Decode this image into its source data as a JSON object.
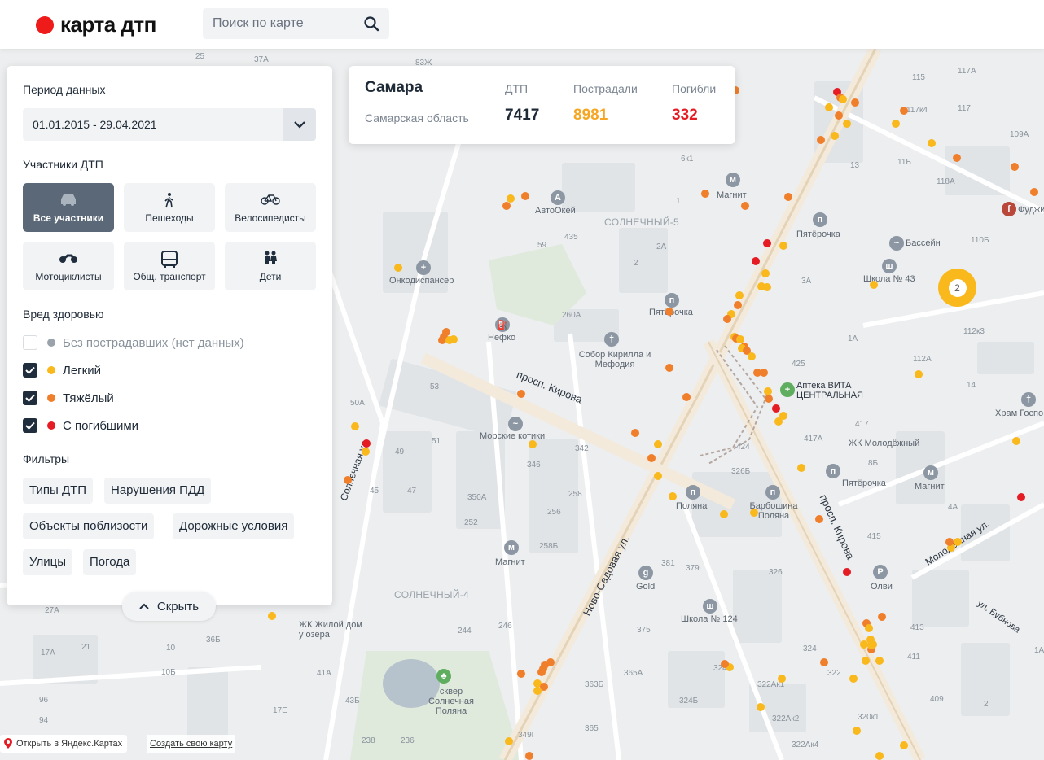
{
  "header": {
    "logo_text": "карта дтп",
    "search_placeholder": "Поиск по карте"
  },
  "stats": {
    "city": "Самара",
    "region": "Самарская область",
    "columns": [
      {
        "label": "ДТП",
        "value": "7417",
        "color": "#1f2a37"
      },
      {
        "label": "Пострадали",
        "value": "8981",
        "color": "#f5a623"
      },
      {
        "label": "Погибли",
        "value": "332",
        "color": "#e51c23"
      }
    ]
  },
  "panel": {
    "period_title": "Период данных",
    "period_value": "01.01.2015 - 29.04.2021",
    "participants_title": "Участники ДТП",
    "participants": [
      {
        "label": "Все участники",
        "icon": "car-icon",
        "active": true
      },
      {
        "label": "Пешеходы",
        "icon": "pedestrian-icon",
        "active": false
      },
      {
        "label": "Велосипедисты",
        "icon": "bicycle-icon",
        "active": false
      },
      {
        "label": "Мотоциклисты",
        "icon": "motorcycle-icon",
        "active": false
      },
      {
        "label": "Общ. транспорт",
        "icon": "bus-icon",
        "active": false
      },
      {
        "label": "Дети",
        "icon": "children-icon",
        "active": false
      }
    ],
    "harm_title": "Вред здоровью",
    "harm": [
      {
        "label": "Без пострадавших (нет данных)",
        "checked": false,
        "color": "#9aa2ab"
      },
      {
        "label": "Легкий",
        "checked": true,
        "color": "#f9b81b"
      },
      {
        "label": "Тяжёлый",
        "checked": true,
        "color": "#f07f2c"
      },
      {
        "label": "С погибшими",
        "checked": true,
        "color": "#e51c23"
      }
    ],
    "filters_title": "Фильтры",
    "filters": [
      "Типы ДТП",
      "Нарушения ПДД",
      "Объекты поблизости",
      "Дорожные условия",
      "Улицы",
      "Погода"
    ],
    "hide_label": "Скрыть"
  },
  "map": {
    "district_labels": [
      "СОЛНЕЧНЫЙ-5",
      "СОЛНЕЧНЫЙ-4"
    ],
    "street_labels": [
      "просп. Кирова",
      "Ново-Садовая ул.",
      "просп. Кирова",
      "Молодёжная ул.",
      "Солнечная ул.",
      "ул. Бубнова"
    ],
    "poi_labels": [
      "АвтоОкей",
      "Магнит",
      "Пятёрочка",
      "Бассейн",
      "Школа № 43",
      "Онкодиспансер",
      "Пятёрочка",
      "Нефко",
      "Собор Кирилла и Мефодия",
      "Аптека ВИТА ЦЕНТРАЛЬНАЯ",
      "Храм Госпо",
      "Морские котики",
      "ЖК Молодёжный",
      "Пятёрочка",
      "Магнит",
      "Поляна",
      "Барбошина Поляна",
      "Магнит",
      "Gold",
      "Олви",
      "Школа № 124",
      "ЖК Жилой дом у озера",
      "сквер Солнечная Поляна",
      "Фуджи"
    ],
    "house_numbers": [
      "25",
      "37А",
      "83Ж",
      "117А",
      "115",
      "117",
      "117к4",
      "109А",
      "11Б",
      "118А",
      "110Б",
      "13",
      "6к1",
      "1",
      "435",
      "59",
      "2А",
      "2",
      "3А",
      "1А",
      "425",
      "112А",
      "112к3",
      "14",
      "417",
      "417А",
      "8Б",
      "4А",
      "415",
      "260А",
      "53",
      "50А",
      "49",
      "51",
      "47",
      "45",
      "346",
      "342",
      "258",
      "256",
      "350А",
      "252",
      "258Б",
      "246",
      "244",
      "381",
      "379",
      "375",
      "326Б",
      "424",
      "326",
      "324",
      "322",
      "322Ак1",
      "322Ак2",
      "322Ак4",
      "324А",
      "324Б",
      "365А",
      "363Б",
      "365",
      "349Г",
      "413",
      "411",
      "409",
      "320к1",
      "27А",
      "21",
      "10",
      "36Б",
      "17А",
      "10Б",
      "96",
      "94",
      "41А",
      "43Б",
      "17Е",
      "238",
      "236",
      "1А",
      "2"
    ],
    "cluster_count": "2",
    "footer_open": "Открыть в Яндекс.Картах",
    "footer_create": "Создать свою карту"
  }
}
